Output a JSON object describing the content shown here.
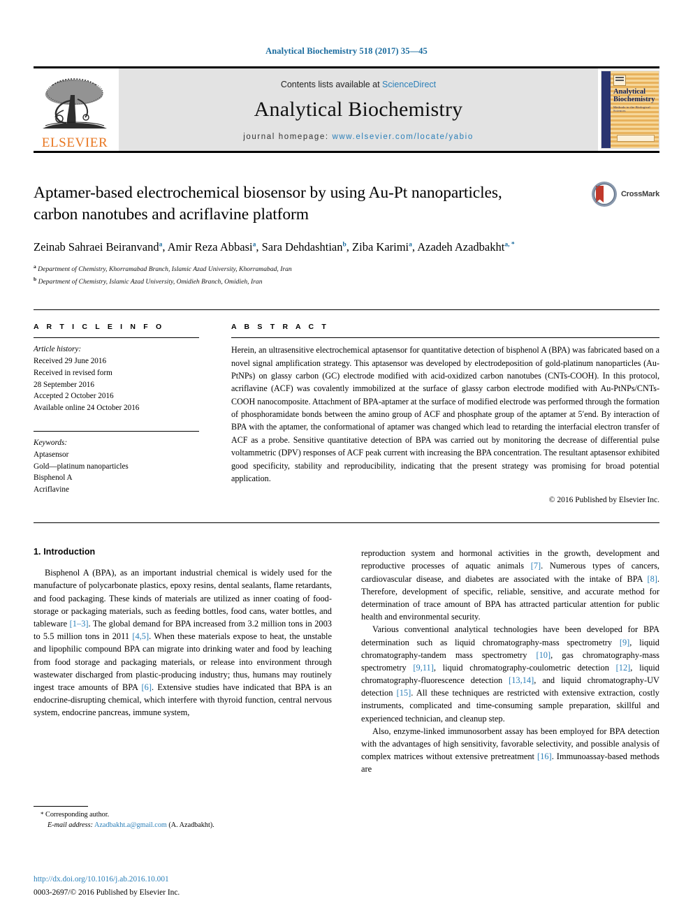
{
  "running_head": "Analytical Biochemistry 518 (2017) 35—45",
  "masthead": {
    "contents_prefix": "Contents lists available at ",
    "sciencedirect": "ScienceDirect",
    "journal_name": "Analytical Biochemistry",
    "homepage_prefix": "journal homepage: ",
    "homepage_url": "www.elsevier.com/locate/yabio",
    "publisher": "ELSEVIER",
    "cover": {
      "title": "Analytical Biochemistry",
      "subtitle": "Methods in the Biological Sciences"
    }
  },
  "article": {
    "title": "Aptamer-based electrochemical biosensor by using Au-Pt nanoparticles, carbon nanotubes and acriflavine platform",
    "authors_line_1": "Zeinab Sahraei Beiranvand ",
    "authors": [
      {
        "name": "Zeinab Sahraei Beiranvand",
        "sup": "a",
        "sep": ", "
      },
      {
        "name": "Amir Reza Abbasi",
        "sup": "a",
        "sep": ", "
      },
      {
        "name": "Sara Dehdashtian",
        "sup": "b",
        "sep": ", "
      },
      {
        "name": "Ziba Karimi",
        "sup": "a",
        "sep": ","
      },
      {
        "name": "Azadeh Azadbakht",
        "sup": "a, *",
        "sep": ""
      }
    ],
    "affiliations": [
      {
        "mark": "a",
        "text": "Department of Chemistry, Khorramabad Branch, Islamic Azad University, Khorramabad, Iran"
      },
      {
        "mark": "b",
        "text": "Department of Chemistry, Islamic Azad University, Omidieh Branch, Omidieh, Iran"
      }
    ],
    "crossmark_label": "CrossMark"
  },
  "article_info": {
    "heading": "A R T I C L E   I N F O",
    "history_label": "Article history:",
    "history": [
      "Received 29 June 2016",
      "Received in revised form",
      "28 September 2016",
      "Accepted 2 October 2016",
      "Available online 24 October 2016"
    ],
    "keywords_label": "Keywords:",
    "keywords": [
      "Aptasensor",
      "Gold—platinum nanoparticles",
      "Bisphenol A",
      "Acriflavine"
    ]
  },
  "abstract": {
    "heading": "A B S T R A C T",
    "text": "Herein, an ultrasensitive electrochemical aptasensor for quantitative detection of bisphenol A (BPA) was fabricated based on a novel signal amplification strategy. This aptasensor was developed by electrodeposition of gold-platinum nanoparticles (Au-PtNPs) on glassy carbon (GC) electrode modified with acid-oxidized carbon nanotubes (CNTs-COOH). In this protocol, acriflavine (ACF) was covalently immobilized at the surface of glassy carbon electrode modified with Au-PtNPs/CNTs-COOH nanocomposite. Attachment of BPA-aptamer at the surface of modified electrode was performed through the formation of phosphoramidate bonds between the amino group of ACF and phosphate group of the aptamer at 5′end. By interaction of BPA with the aptamer, the conformational of aptamer was changed which lead to retarding the interfacial electron transfer of ACF as a probe. Sensitive quantitative detection of BPA was carried out by monitoring the decrease of differential pulse voltammetric (DPV) responses of ACF peak current with increasing the BPA concentration. The resultant aptasensor exhibited good specificity, stability and reproducibility, indicating that the present strategy was promising for broad potential application.",
    "copyright": "© 2016 Published by Elsevier Inc."
  },
  "body": {
    "section_title": "1.  Introduction",
    "left_paragraphs": [
      "Bisphenol A (BPA), as an important industrial chemical is widely used for the manufacture of polycarbonate plastics, epoxy resins, dental sealants, flame retardants, and food packaging. These kinds of materials are utilized as inner coating of food-storage or packaging materials, such as feeding bottles, food cans, water bottles, and tableware [1—3]. The global demand for BPA increased from 3.2 million tons in 2003 to 5.5 million tons in 2011 [4,5]. When these materials expose to heat, the unstable and lipophilic compound BPA can migrate into drinking water and food by leaching from food storage and packaging materials, or release into environment through wastewater discharged from plastic-producing industry; thus, humans may routinely ingest trace amounts of BPA [6]. Extensive studies have indicated that BPA is an endocrine-disrupting chemical, which interfere with thyroid function, central nervous system, endocrine pancreas, immune system,"
    ],
    "right_paragraphs": [
      "reproduction system and hormonal activities in the growth, development and reproductive processes of aquatic animals [7]. Numerous types of cancers, cardiovascular disease, and diabetes are associated with the intake of BPA [8]. Therefore, development of specific, reliable, sensitive, and accurate method for determination of trace amount of BPA has attracted particular attention for public health and environmental security.",
      "Various conventional analytical technologies have been developed for BPA determination such as liquid chromatography-mass spectrometry [9], liquid chromatography-tandem mass spectrometry [10], gas chromatography-mass spectrometry [9,11], liquid chromatography-coulometric detection [12], liquid chromatography-fluorescence detection [13,14], and liquid chromatography-UV detection [15]. All these techniques are restricted with extensive extraction, costly instruments, complicated and time-consuming sample preparation, skillful and experienced technician, and cleanup step.",
      "Also, enzyme-linked immunosorbent assay has been employed for BPA detection with the advantages of high sensitivity, favorable selectivity, and possible analysis of complex matrices without extensive pretreatment [16]. Immunoassay-based methods are"
    ]
  },
  "footnote": {
    "star": "*",
    "corresponding": "Corresponding author.",
    "email_label": "E-mail address:",
    "email": "Azadbakht.a@gmail.com",
    "email_owner": "(A. Azadbakht)."
  },
  "footer": {
    "doi": "http://dx.doi.org/10.1016/j.ab.2016.10.001",
    "issn": "0003-2697/© 2016 Published by Elsevier Inc."
  },
  "colors": {
    "link": "#2b7fb8",
    "running_head": "#1a6b9e",
    "elsevier_orange": "#e87722",
    "band_gray": "#e3e3e3"
  }
}
